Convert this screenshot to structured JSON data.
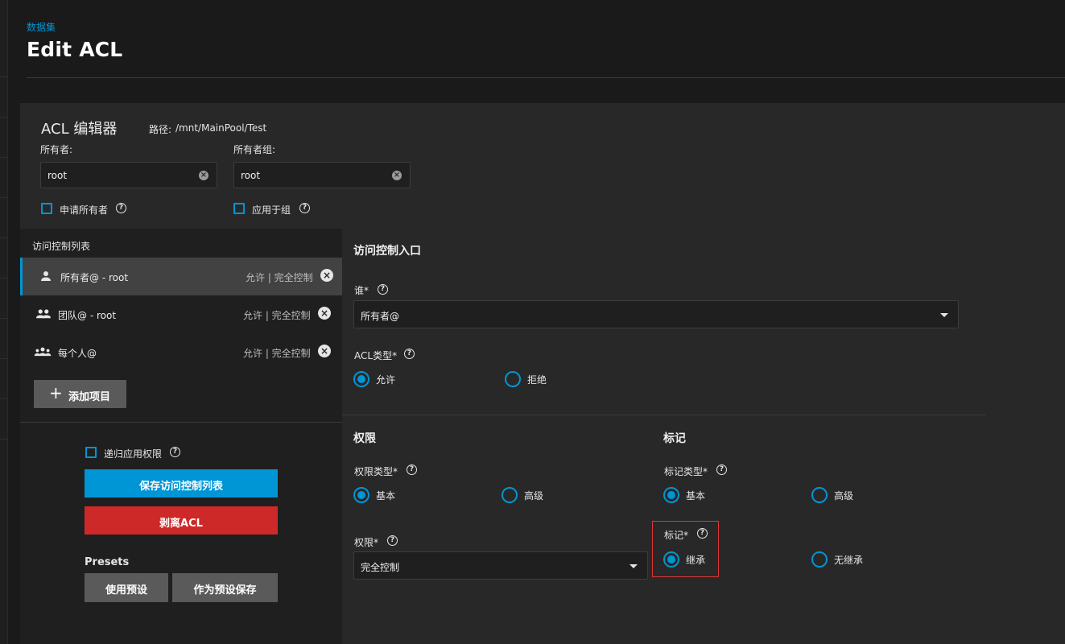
{
  "header": {
    "breadcrumb": "数据集",
    "title": "Edit ACL"
  },
  "editor": {
    "title": "ACL 编辑器",
    "path_label": "路径:",
    "path_value": "/mnt/MainPool/Test",
    "owner_label": "所有者:",
    "owner_value": "root",
    "group_label": "所有者组:",
    "group_value": "root",
    "apply_owner_label": "申请所有者",
    "apply_group_label": "应用于组"
  },
  "acl_list": {
    "title": "访问控制列表",
    "items": [
      {
        "name": "所有者@ - root",
        "perm": "允许 | 完全控制",
        "icon": "user-icon"
      },
      {
        "name": "团队@ - root",
        "perm": "允许 | 完全控制",
        "icon": "group-icon"
      },
      {
        "name": "每个人@",
        "perm": "允许 | 完全控制",
        "icon": "everyone-icon"
      }
    ],
    "add_label": "添加项目"
  },
  "actions": {
    "recursive_label": "递归应用权限",
    "save_label": "保存访问控制列表",
    "strip_label": "剥离ACL",
    "presets_title": "Presets",
    "use_preset_label": "使用预设",
    "save_preset_label": "作为预设保存"
  },
  "entry": {
    "title": "访问控制入口",
    "who_label": "谁*",
    "who_value": "所有者@",
    "acl_type_label": "ACL类型*",
    "acl_allow": "允许",
    "acl_deny": "拒绝",
    "permissions_title": "权限",
    "perm_type_label": "权限类型*",
    "perm_basic": "基本",
    "perm_advanced": "高级",
    "perm_label": "权限*",
    "perm_value": "完全控制",
    "flags_title": "标记",
    "flag_type_label": "标记类型*",
    "flag_basic": "基本",
    "flag_advanced": "高级",
    "flags_label": "标记*",
    "flag_inherit": "继承",
    "flag_no_inherit": "无继承"
  },
  "colors": {
    "accent": "#0095d5",
    "danger": "#ce2929",
    "highlight": "#e03535"
  }
}
